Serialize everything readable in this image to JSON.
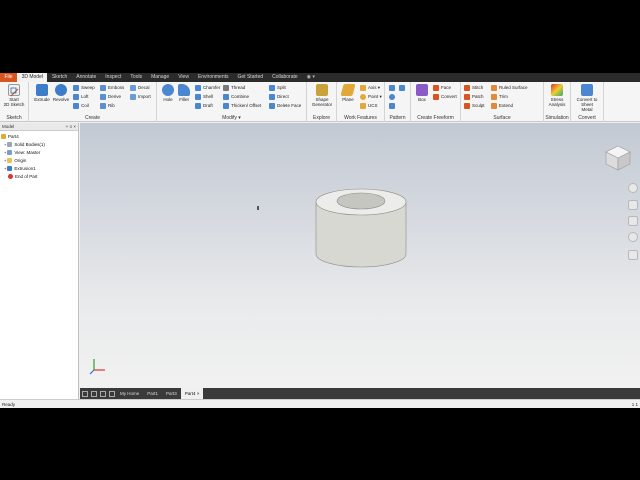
{
  "ribbon_tabs": [
    "File",
    "3D Model",
    "Sketch",
    "Annotate",
    "Inspect",
    "Tools",
    "Manage",
    "View",
    "Environments",
    "Get Started",
    "Collaborate"
  ],
  "ribbon_extra": "◉ ▾",
  "panels": {
    "sketch": {
      "label": "Sketch",
      "start_sketch": "Start\n2D Sketch"
    },
    "create": {
      "label": "Create",
      "extrude": "Extrude",
      "revolve": "Revolve",
      "sweep": "Sweep",
      "loft": "Loft",
      "coil": "Coil",
      "emboss": "Emboss",
      "derive": "Derive",
      "rib": "Rib",
      "decal": "Decal",
      "import": "Import"
    },
    "modify": {
      "label": "Modify ▾",
      "hole": "Hole",
      "fillet": "Fillet",
      "chamfer": "Chamfer",
      "shell": "Shell",
      "draft": "Draft",
      "thread": "Thread",
      "combine": "Combine",
      "thicken": "Thicken/ Offset",
      "split": "Split",
      "direct": "Direct",
      "delete_face": "Delete Face"
    },
    "explore": {
      "label": "Explore",
      "shape_generator": "Shape\nGenerator"
    },
    "work_features": {
      "label": "Work Features",
      "plane": "Plane",
      "axis": "Axis ▾",
      "point": "Point ▾",
      "ucs": "UCS"
    },
    "pattern": {
      "label": "Pattern"
    },
    "freeform": {
      "label": "Create Freeform",
      "box": "Box",
      "face": "Face",
      "convert": "Convert"
    },
    "surface": {
      "label": "Surface",
      "stitch": "Stitch",
      "patch": "Patch",
      "sculpt": "Sculpt",
      "ruled_surface": "Ruled Surface",
      "trim": "Trim",
      "extend": "Extend"
    },
    "simulation": {
      "label": "Simulation",
      "stress_analysis": "Stress\nAnalysis"
    },
    "convert": {
      "label": "Convert",
      "convert_sheet_metal": "Convert to\nSheet Metal"
    }
  },
  "browser": {
    "header": "Model",
    "header_controls": "+ ≡ ×",
    "items": [
      "Part4",
      "Solid Bodies(1)",
      "View: Master",
      "Origin",
      "Extrusion1",
      "End of Part"
    ]
  },
  "doc_tabs": [
    "My Home",
    "Part1",
    "Part3",
    "Part4"
  ],
  "doc_tab_close": "×",
  "status": {
    "left": "Ready",
    "right": "1  1"
  },
  "viewcube_label": "TOP",
  "colors": {
    "file_tab": "#d9541e",
    "ribbon_bg": "#f5f5f5",
    "part_body": "#d8d8d2",
    "part_edge": "#8c8c86",
    "part_hole": "#c6c6c0"
  }
}
